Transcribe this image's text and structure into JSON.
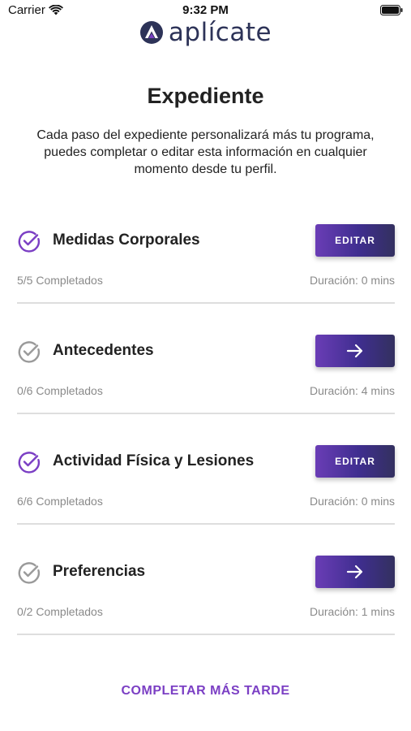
{
  "status_bar": {
    "carrier": "Carrier",
    "time": "9:32 PM",
    "wifi_icon": "wifi-icon",
    "battery_icon": "battery-icon"
  },
  "logo": {
    "text": "aplícate",
    "icon": "aplicate-logo-mark",
    "color": "#2d3358"
  },
  "header": {
    "title": "Expediente",
    "description": "Cada paso del expediente personalizará más tu programa, puedes completar o editar esta información en cualquier momento desde tu perfil."
  },
  "steps": [
    {
      "title": "Medidas Corporales",
      "status": "complete",
      "button_type": "edit",
      "button_label": "EDITAR",
      "progress": "5/5 Completados",
      "duration": "Duración: 0 mins"
    },
    {
      "title": "Antecedentes",
      "status": "incomplete",
      "button_type": "arrow",
      "button_label": "",
      "progress": "0/6 Completados",
      "duration": "Duración: 4 mins"
    },
    {
      "title": "Actividad Física y Lesiones",
      "status": "complete",
      "button_type": "edit",
      "button_label": "EDITAR",
      "progress": "6/6 Completados",
      "duration": "Duración: 0 mins"
    },
    {
      "title": "Preferencias",
      "status": "incomplete",
      "button_type": "arrow",
      "button_label": "",
      "progress": "0/2 Completados",
      "duration": "Duración: 1 mins"
    }
  ],
  "footer": {
    "later_label": "COMPLETAR MÁS TARDE"
  },
  "colors": {
    "accent": "#7b3fc4",
    "check_complete": "#7b3fc4",
    "check_incomplete": "#9a9a9a",
    "button_gradient_start": "#6a3db6",
    "button_gradient_end": "#33305f",
    "muted_text": "#8a8a8a",
    "divider": "#dedede"
  }
}
